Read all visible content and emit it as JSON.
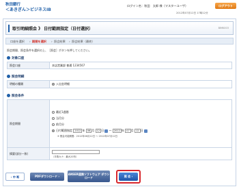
{
  "header": {
    "bank_name": "秋田銀行",
    "service_name": "＜あきぎん＞ビジネスIB",
    "login_info": "ログイン名：秋田　太郎 様（マスターユーザ）",
    "logout_label": "ログアウト",
    "datetime": "2012年07月12日 17時12分"
  },
  "title": {
    "text": "取引明細照会 》 日付範囲指定（日付選択）",
    "code": "BIMK003"
  },
  "steps": [
    "口座を選択",
    "期間を選択",
    "照会結果",
    "照会結果（最終）"
  ],
  "intro_text": "照会期間、照会条件を選択の上、［照会］ボタンを押してください。",
  "sections": {
    "account": {
      "heading": "対象口座",
      "label": "照会口座",
      "value": "本店営業部 普通 1234567"
    },
    "details": {
      "heading": "照会明細",
      "label": "明細の種類",
      "value": "入出金明細"
    },
    "conditions": {
      "heading": "照会条件",
      "period_label": "照会期間",
      "options": [
        "最近1週間",
        "当月分",
        "前月分",
        "日付範囲指定"
      ],
      "date_from": {
        "year": "2012",
        "month": "06",
        "day": "12"
      },
      "date_to": {
        "year": "2012",
        "month": "07",
        "day": "12"
      },
      "unit_year": "年",
      "unit_month": "月",
      "unit_day": "日",
      "range_sep": "〜",
      "range_note": "※ 照会可能期間：2012年06月12日 〜 2012年07月12日",
      "note_label": "摘要(部分一致)",
      "note_value": "",
      "note_hint": "（半角カナ：最大20桁）"
    }
  },
  "buttons": {
    "back": "中 断",
    "pdf": "PDFダウンロード",
    "anser": "ANSER連携ソフトウェア ダウンロード",
    "submit": "照 会"
  }
}
